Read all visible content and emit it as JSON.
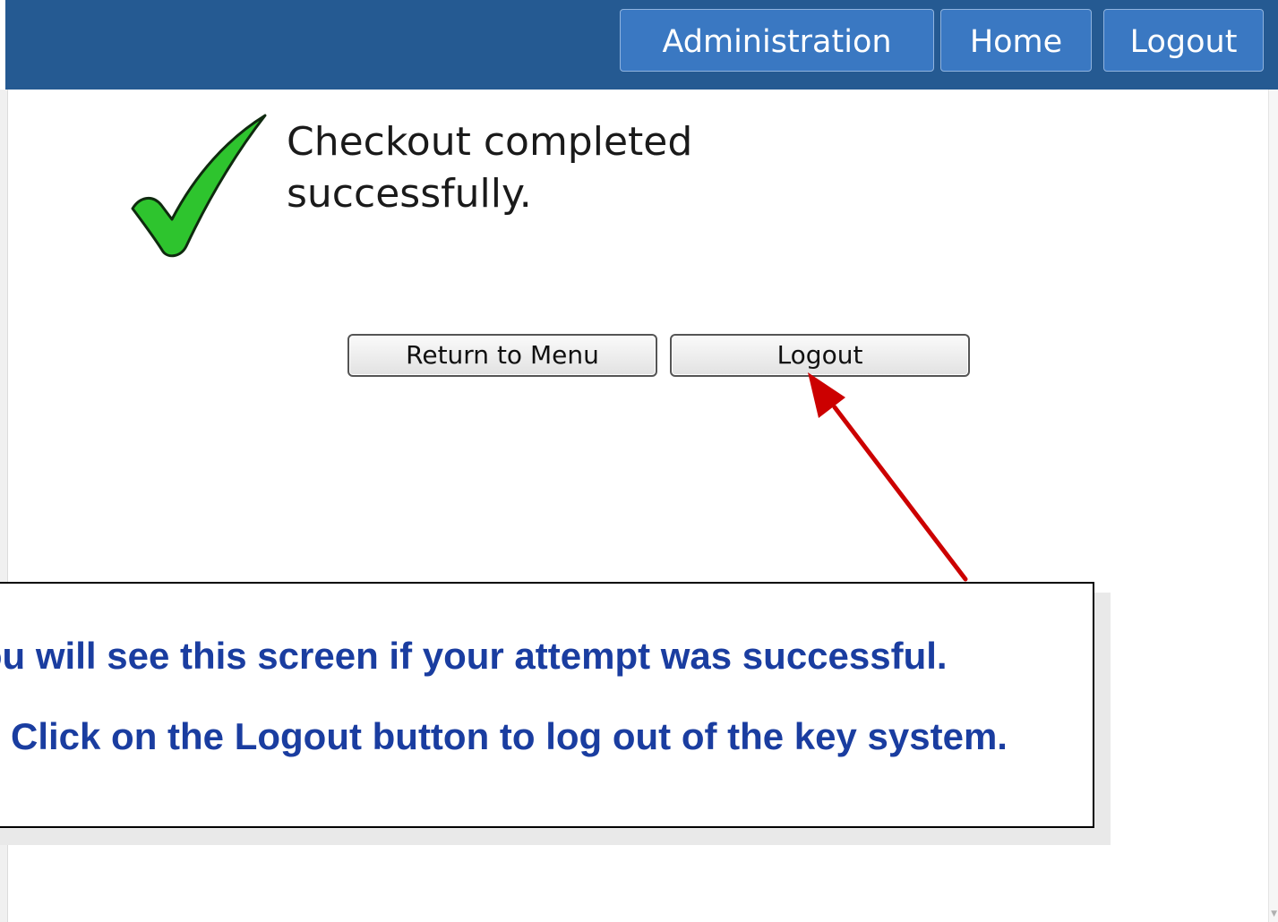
{
  "nav": {
    "administration_label": "Administration",
    "home_label": "Home",
    "logout_label": "Logout"
  },
  "status": {
    "icon": "checkmark-icon",
    "message": "Checkout completed successfully."
  },
  "actions": {
    "return_label": "Return to Menu",
    "logout_label": "Logout"
  },
  "callout": {
    "line1": "You will see this screen if your attempt was successful.",
    "line2": "Click on the Logout button to log out of the key system."
  },
  "colors": {
    "nav_bar": "#255a92",
    "nav_button": "#3a78c2",
    "check_fill": "#2ec42e",
    "arrow": "#cc0000",
    "callout_text": "#1a3da0"
  }
}
